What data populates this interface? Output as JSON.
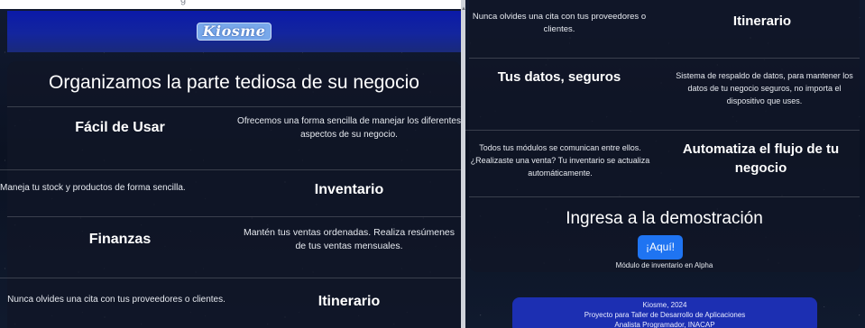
{
  "top_caption": "g",
  "brand": {
    "logo_text": "Kiosme"
  },
  "left": {
    "headline": "Organizamos la parte tediosa de su negocio",
    "rows": [
      {
        "heading": "Fácil de Usar",
        "text": "Ofrecemos una forma sencilla de manejar los diferentes aspectos de su negocio."
      },
      {
        "heading": "Inventario",
        "text": "Maneja tu stock y productos de forma sencilla."
      },
      {
        "heading": "Finanzas",
        "text": "Mantén tus ventas ordenadas. Realiza resúmenes de tus ventas mensuales."
      },
      {
        "heading": "Itinerario",
        "text": "Nunca olvides una cita con tus proveedores o clientes."
      }
    ]
  },
  "right": {
    "rows": [
      {
        "heading": "Itinerario",
        "text": "Nunca olvides una cita con tus proveedores o clientes."
      },
      {
        "heading": "Tus datos, seguros",
        "text": "Sistema de respaldo de datos, para mantener los datos de tu negocio seguros, no importa el dispositivo que uses."
      },
      {
        "heading": "Automatiza el flujo de tu negocio",
        "text": "Todos tus módulos se comunican entre ellos. ¿Realizaste una venta? Tu inventario se actualiza automáticamente."
      }
    ],
    "demo": {
      "title": "Ingresa a la demostración",
      "button_label": "¡Aquí!",
      "note": "Módulo de inventario en Alpha"
    },
    "footer": {
      "line1": "Kiosme, 2024",
      "line2": "Proyecto para Taller de Desarrollo de Aplicaciones",
      "line3": "Analista Programador, INACAP"
    }
  },
  "colors": {
    "header_blue": "#13259e",
    "button_blue": "#1f74f2",
    "footer_blue": "#1c2fb2",
    "panel_dark": "#111626"
  }
}
